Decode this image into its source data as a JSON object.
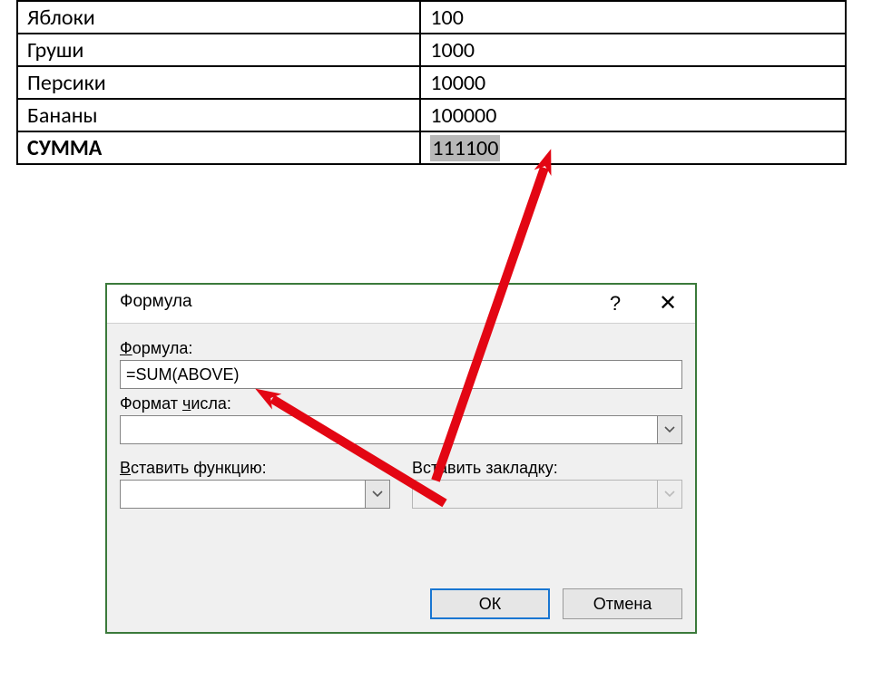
{
  "table": {
    "rows": [
      {
        "label": "Яблоки",
        "value": "100"
      },
      {
        "label": "Груши",
        "value": "1000"
      },
      {
        "label": "Персики",
        "value": "10000"
      },
      {
        "label": "Бананы",
        "value": "100000"
      }
    ],
    "sum_label": "СУММА",
    "sum_value": "111100"
  },
  "dialog": {
    "title": "Формула",
    "help_symbol": "?",
    "close_symbol": "✕",
    "formula_label_prefix": "Ф",
    "formula_label_rest": "ормула:",
    "formula_value": "=SUM(ABOVE)",
    "number_format_label_pre": "Формат ",
    "number_format_label_ul": "ч",
    "number_format_label_post": "исла:",
    "number_format_value": "",
    "insert_function_label_ul": "В",
    "insert_function_label_rest": "ставить функцию:",
    "insert_function_value": "",
    "insert_bookmark_label": "Вставить закладку:",
    "insert_bookmark_value": "",
    "ok_label": "ОК",
    "cancel_label": "Отмена"
  }
}
